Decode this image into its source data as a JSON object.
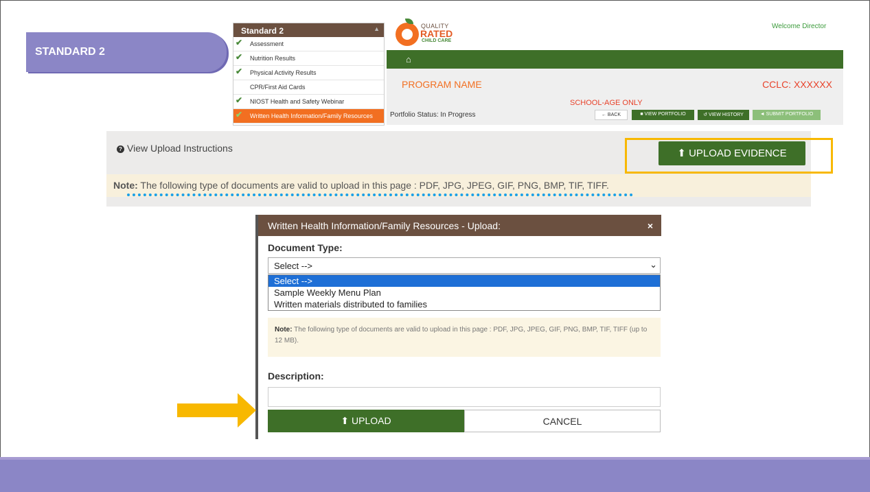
{
  "slide": {
    "title": "STANDARD 2"
  },
  "sidemenu": {
    "header": "Standard 2",
    "items": [
      {
        "label": "Assessment",
        "checked": true,
        "active": false
      },
      {
        "label": "Nutrition Results",
        "checked": true,
        "active": false
      },
      {
        "label": "Physical Activity Results",
        "checked": true,
        "active": false
      },
      {
        "label": "CPR/First Aid Cards",
        "checked": false,
        "active": false
      },
      {
        "label": "NIOST Health and Safety Webinar",
        "checked": true,
        "active": false
      },
      {
        "label": "Written Health Information/Family Resources",
        "checked": true,
        "active": true
      }
    ]
  },
  "logo": {
    "line1": "QUALITY",
    "line2": "RATED",
    "line3": "CHILD CARE"
  },
  "header": {
    "welcome": "Welcome Director"
  },
  "program": {
    "name": "PROGRAM NAME",
    "cclc": "CCLC: XXXXXX",
    "school_age": "SCHOOL-AGE ONLY",
    "status": "Portfolio Status: In Progress"
  },
  "toolbar": {
    "back": "← BACK",
    "view_portfolio": "■ VIEW PORTFOLIO",
    "view_history": "↺ VIEW HISTORY",
    "submit_portfolio": "◄ SUBMIT PORTFOLIO"
  },
  "upload_panel": {
    "instructions": "View Upload Instructions",
    "upload_evidence": "UPLOAD EVIDENCE",
    "note_label": "Note:",
    "note_text": " The following type of documents are valid to upload in this page : PDF, JPG, JPEG, GIF, PNG, BMP, TIF, TIFF."
  },
  "modal": {
    "title": "Written Health Information/Family Resources - Upload:",
    "close": "×",
    "doc_type_label": "Document Type:",
    "selected": "Select -->",
    "options": [
      "Select -->",
      "Sample Weekly Menu Plan",
      "Written materials distributed to families"
    ],
    "note_label": "Note:",
    "note_text": " The following type of documents are valid to upload in this page : PDF, JPG, JPEG, GIF, PNG, BMP, TIF, TIFF (up to 12 MB).",
    "description_label": "Description:",
    "description_value": "",
    "upload": "UPLOAD",
    "cancel": "CANCEL"
  },
  "colors": {
    "brand_green": "#3e6f28",
    "accent_orange": "#f26f21",
    "slide_purple": "#8b86c6",
    "highlight_yellow": "#f8b800",
    "header_brown": "#6b5040"
  }
}
